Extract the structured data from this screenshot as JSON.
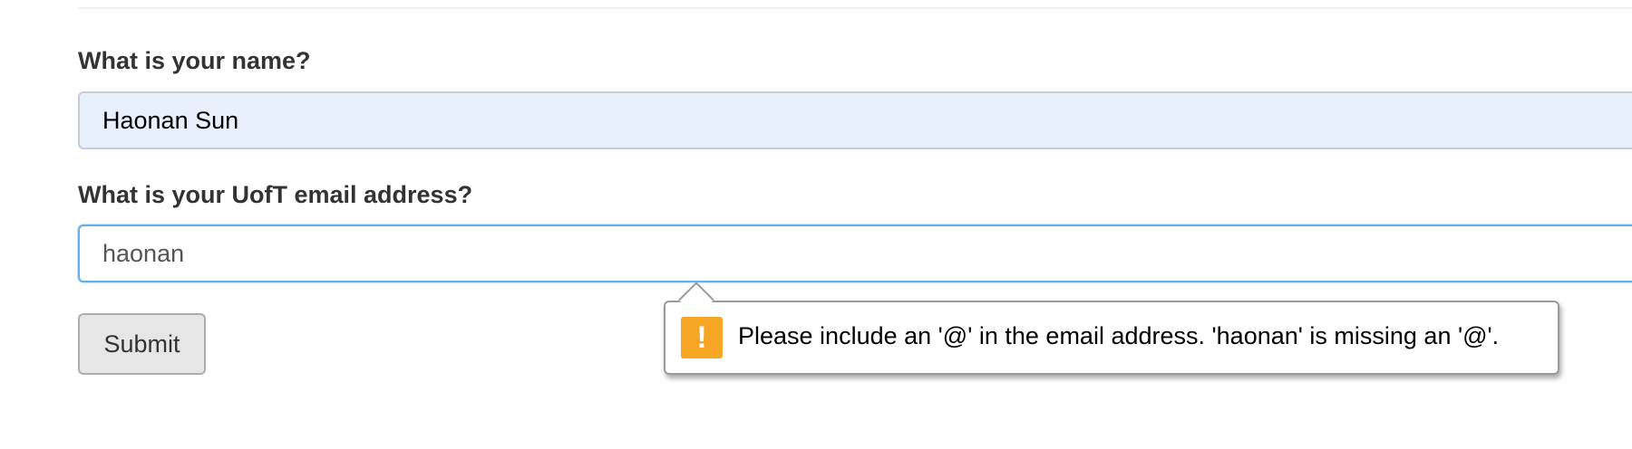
{
  "form": {
    "name_label": "What is your name?",
    "name_value": "Haonan Sun",
    "email_label": "What is your UofT email address?",
    "email_value": "haonan",
    "submit_label": "Submit"
  },
  "validation": {
    "icon": "warning-exclamation-icon",
    "icon_glyph": "!",
    "icon_color": "#f6a524",
    "message": "Please include an '@' in the email address. 'haonan' is missing an '@'."
  },
  "colors": {
    "autofill_background": "#e8f0fe",
    "focus_border": "#66afe9"
  }
}
